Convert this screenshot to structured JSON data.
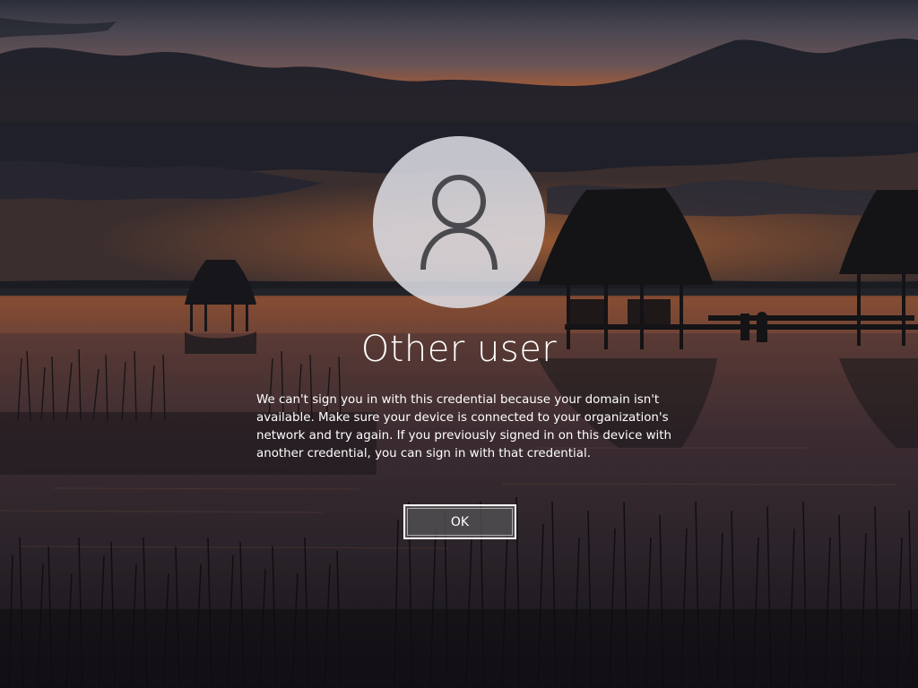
{
  "lock_screen": {
    "user_name": "Other user",
    "message": "We can't sign you in with this credential because your domain isn't\navailable. Make sure your device is connected to your organization's\nnetwork and try again. If you previously signed in on this device with\nanother credential, you can sign in with that credential.",
    "ok_label": "OK",
    "avatar_icon": "user-icon"
  },
  "background": {
    "scene": "lake-sunset-with-palapas",
    "sky_top": "#2a2d38",
    "horizon_glow": "#c8652a",
    "water": "#2b2023"
  }
}
